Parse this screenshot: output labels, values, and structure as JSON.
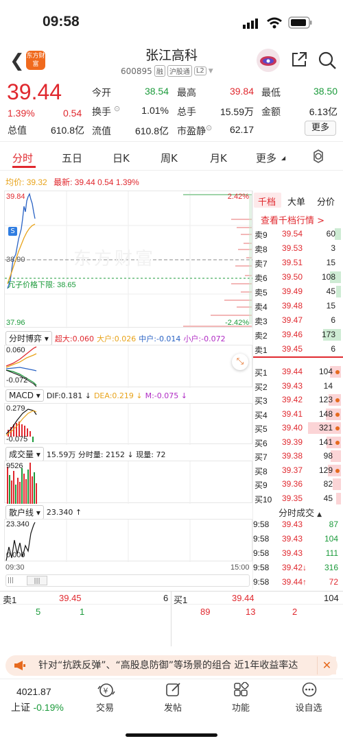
{
  "status_bar": {
    "time": "09:58"
  },
  "header": {
    "logo_text": "东方财富",
    "stock_name": "张江高科",
    "stock_code": "600895",
    "tags": [
      "融",
      "沪股通",
      "L2"
    ]
  },
  "quote": {
    "price": "39.44",
    "change_pct": "1.39%",
    "change": "0.54",
    "rows": [
      [
        {
          "label": "今开",
          "value": "38.54",
          "color": "green"
        },
        {
          "label": "最高",
          "value": "39.84",
          "color": "red"
        },
        {
          "label": "最低",
          "value": "38.50",
          "color": "green"
        }
      ],
      [
        {
          "label": "换手",
          "value": "1.01%",
          "color": "dark"
        },
        {
          "label": "总手",
          "value": "15.59万",
          "color": "dark"
        },
        {
          "label": "金额",
          "value": "6.13亿",
          "color": "dark"
        }
      ],
      [
        {
          "label": "流值",
          "value": "610.8亿",
          "color": "dark"
        },
        {
          "label": "市盈静",
          "value": "62.17",
          "color": "dark"
        }
      ]
    ],
    "total_value_label": "总值",
    "total_value": "610.8亿",
    "more_label": "更多"
  },
  "tabs": [
    "分时",
    "五日",
    "日K",
    "周K",
    "月K",
    "更多"
  ],
  "chart": {
    "avg_label": "均价:",
    "avg_value": "39.32",
    "latest_label": "最新:",
    "latest_value": "39.44",
    "latest_change": "0.54",
    "latest_pct": "1.39%",
    "high": "39.84",
    "mid": "38.90",
    "low": "37.96",
    "pct_high": "2.42%",
    "pct_low": "-2.42%",
    "limit_label": "冗子价格下限: 38.65",
    "watermark": "东方财富",
    "time_start": "09:30",
    "time_end": "15:00"
  },
  "indicators": {
    "game": {
      "btn": "分时博弈",
      "top": "0.060",
      "bottom": "-0.072",
      "items": [
        {
          "t": "超大:0.060",
          "c": "red"
        },
        {
          "t": "大户:0.026",
          "c": "orange"
        },
        {
          "t": "中户:-0.014",
          "c": "blue"
        },
        {
          "t": "小户:-0.072",
          "c": "purple"
        }
      ]
    },
    "macd": {
      "btn": "MACD",
      "top": "0.279",
      "bottom": "-0.075",
      "items": [
        {
          "t": "DIF:0.181 ↓",
          "c": "dark"
        },
        {
          "t": "DEA:0.219 ↓",
          "c": "orange"
        },
        {
          "t": "M:-0.075 ↓",
          "c": "purple"
        }
      ]
    },
    "volume": {
      "btn": "成交量",
      "top": "9526",
      "items": [
        {
          "t": "15.59万  分时量: 2152 ↓  现量: 72",
          "c": "dark"
        }
      ]
    },
    "retail": {
      "btn": "散户线",
      "top": "23.340",
      "bottom": "0.000",
      "items": [
        {
          "t": "23.340 ↑",
          "c": "dark"
        }
      ]
    }
  },
  "orderbook": {
    "tabs": [
      "千档",
      "大单",
      "分价"
    ],
    "link": "查看千档行情 >",
    "asks": [
      {
        "label": "卖9",
        "price": "39.54",
        "vol": "60"
      },
      {
        "label": "卖8",
        "price": "39.53",
        "vol": "3"
      },
      {
        "label": "卖7",
        "price": "39.51",
        "vol": "15"
      },
      {
        "label": "卖6",
        "price": "39.50",
        "vol": "108"
      },
      {
        "label": "卖5",
        "price": "39.49",
        "vol": "45"
      },
      {
        "label": "卖4",
        "price": "39.48",
        "vol": "15"
      },
      {
        "label": "卖3",
        "price": "39.47",
        "vol": "6"
      },
      {
        "label": "卖2",
        "price": "39.46",
        "vol": "173"
      },
      {
        "label": "卖1",
        "price": "39.45",
        "vol": "6"
      }
    ],
    "bids": [
      {
        "label": "买1",
        "price": "39.44",
        "vol": "104"
      },
      {
        "label": "买2",
        "price": "39.43",
        "vol": "14"
      },
      {
        "label": "买3",
        "price": "39.42",
        "vol": "123"
      },
      {
        "label": "买4",
        "price": "39.41",
        "vol": "148"
      },
      {
        "label": "买5",
        "price": "39.40",
        "vol": "321"
      },
      {
        "label": "买6",
        "price": "39.39",
        "vol": "141"
      },
      {
        "label": "买7",
        "price": "39.38",
        "vol": "98"
      },
      {
        "label": "买8",
        "price": "39.37",
        "vol": "129"
      },
      {
        "label": "买9",
        "price": "39.36",
        "vol": "82"
      },
      {
        "label": "买10",
        "price": "39.35",
        "vol": "45"
      }
    ],
    "trades_title": "分时成交",
    "trades": [
      {
        "time": "9:58",
        "price": "39.43",
        "vol": "87",
        "c": "green"
      },
      {
        "time": "9:58",
        "price": "39.43",
        "vol": "104",
        "c": "green"
      },
      {
        "time": "9:58",
        "price": "39.43",
        "vol": "111",
        "c": "green"
      },
      {
        "time": "9:58",
        "price": "39.42↓",
        "vol": "316",
        "c": "green"
      },
      {
        "time": "9:58",
        "price": "39.44↑",
        "vol": "72",
        "c": "red"
      }
    ]
  },
  "level1": {
    "sell_label": "卖1",
    "sell_price": "39.45",
    "sell_vol": "6",
    "buy_label": "买1",
    "buy_price": "39.44",
    "buy_vol": "104",
    "sell_queue": [
      "5",
      "1"
    ],
    "buy_queue": [
      "89",
      "13",
      "2"
    ]
  },
  "notice": {
    "text": "针对“抗跌反弹”、“高股息防御”等场景的组合 近1年收益率达"
  },
  "bottom_nav": {
    "index_value": "4021.87",
    "index_name": "上证",
    "index_change": "-0.19%",
    "items": [
      "交易",
      "发帖",
      "功能",
      "设自选"
    ]
  }
}
